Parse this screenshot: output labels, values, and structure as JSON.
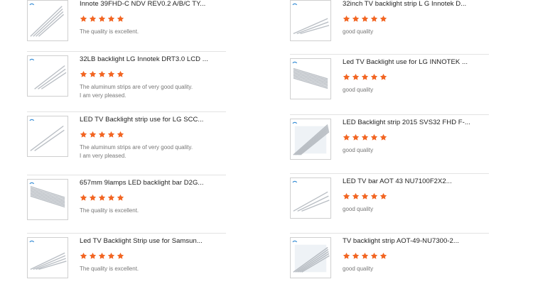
{
  "colors": {
    "star": "#f26522",
    "border": "#cfcfcf"
  },
  "left": [
    {
      "title": "Innote 39FHD-C NDV REV0.2 A/B/C TY...",
      "rating": 5,
      "review": [
        "The quality is excellent."
      ]
    },
    {
      "title": "32LB backlight LG Innotek DRT3.0 LCD ...",
      "rating": 5,
      "review": [
        "The aluminum strips are of very good quality.",
        "I am very pleased."
      ]
    },
    {
      "title": "LED TV Backlight strip use for LG SCC...",
      "rating": 5,
      "review": [
        "The aluminum strips are of very good quality.",
        "I am very pleased."
      ]
    },
    {
      "title": "657mm 9lamps LED backlight bar D2G...",
      "rating": 5,
      "review": [
        "The quality is excellent."
      ]
    },
    {
      "title": "Led TV Backlight Strip use for Samsun...",
      "rating": 5,
      "review": [
        "The quality is excellent."
      ]
    }
  ],
  "right": [
    {
      "title": "32inch TV backlight strip L G Innotek D...",
      "rating": 5,
      "review": [
        "good quality"
      ]
    },
    {
      "title": "Led TV Backlight use for LG INNOTEK ...",
      "rating": 5,
      "review": [
        "good quality"
      ]
    },
    {
      "title": "LED Backlight strip 2015 SVS32 FHD F-...",
      "rating": 5,
      "review": [
        "good quality"
      ]
    },
    {
      "title": "LED TV bar AOT 43 NU7100F2X2...",
      "rating": 5,
      "review": [
        "good quality"
      ]
    },
    {
      "title": "TV backlight strip AOT-49-NU7300-2...",
      "rating": 5,
      "review": [
        "good quality"
      ]
    }
  ]
}
